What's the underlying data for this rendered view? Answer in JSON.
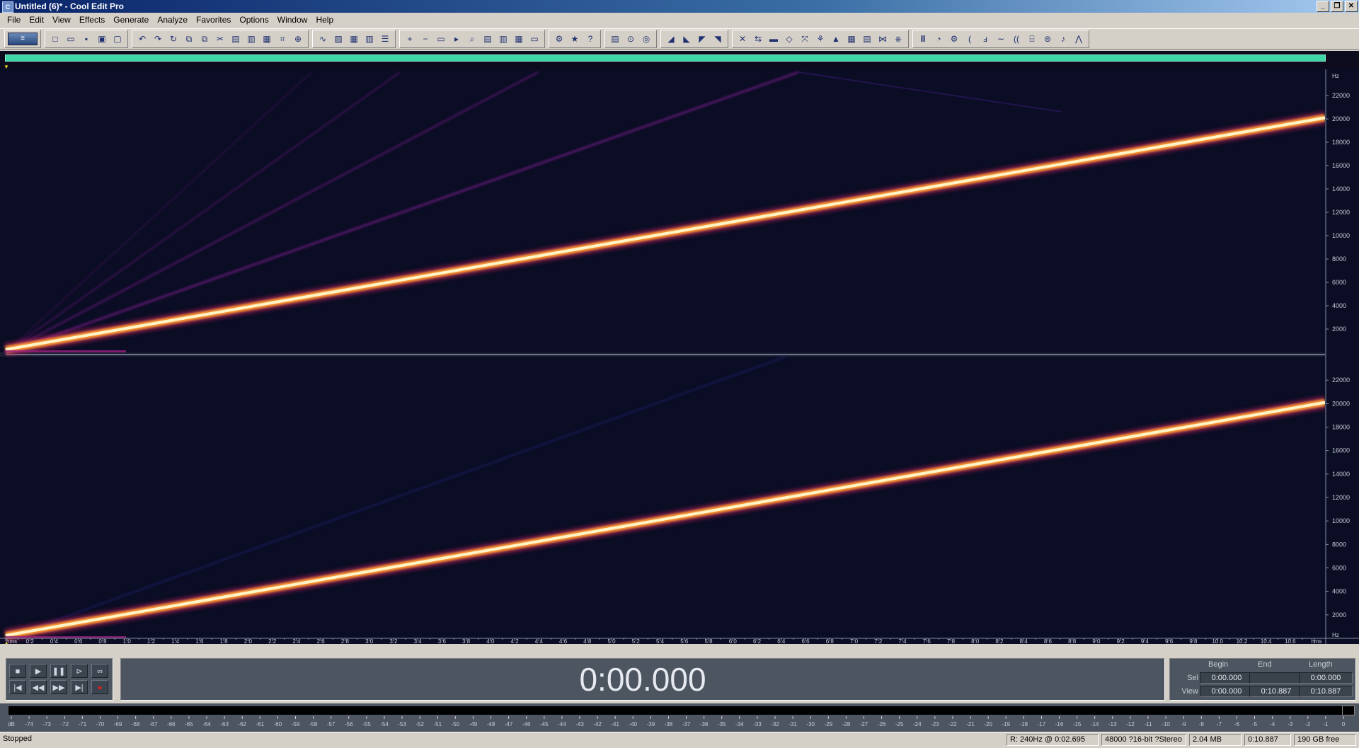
{
  "app": {
    "title": "Untitled (6)* - Cool Edit Pro",
    "icon": "cool-edit-app-icon",
    "window_buttons": [
      "_",
      "❐",
      "✕"
    ]
  },
  "menu": [
    "File",
    "Edit",
    "View",
    "Effects",
    "Generate",
    "Analyze",
    "Favorites",
    "Options",
    "Window",
    "Help"
  ],
  "toolbar": {
    "groups": [
      [
        "multitrack-toggle-icon"
      ],
      [
        "new-file-icon",
        "open-file-icon",
        "save-icon",
        "save-all-icon",
        "close-file-icon"
      ],
      [
        "undo-icon",
        "redo-icon",
        "repeat-icon",
        "copy-icon",
        "copy-new-icon",
        "cut-icon",
        "paste-icon",
        "paste-new-icon",
        "mix-paste-icon",
        "crop-icon",
        "insert-icon"
      ],
      [
        "waveform-view-icon",
        "spectral-view-icon",
        "grid-icon",
        "markers-icon",
        "cue-list-icon"
      ],
      [
        "zoom-in-icon",
        "zoom-out-icon",
        "zoom-full-icon",
        "play-cursor-icon",
        "zoom-selection-icon",
        "frames-icon",
        "bars-icon",
        "time-format-icon",
        "info-icon"
      ],
      [
        "settings-icon",
        "favorites-icon",
        "help-icon"
      ],
      [
        "channel-view-icon",
        "zoom-magnify-icon",
        "spectral-zoom-icon"
      ],
      [
        "amplify-icon",
        "normalize-icon",
        "envelope-icon",
        "fade-icon"
      ],
      [
        "noise-reduction-icon",
        "reverse-icon",
        "silence-icon",
        "invert-icon",
        "dynamics-icon",
        "filter-icon",
        "pitch-icon",
        "stretch-icon",
        "delay-icon",
        "chorus-icon",
        "echo-icon"
      ],
      [
        "graphic-eq-icon",
        "timer-icon",
        "gear-icon",
        "reverb-icon",
        "flanger-icon",
        "sweep-icon",
        "echo-chamber-icon",
        "distortion-icon",
        "hard-limit-icon",
        "music-icon",
        "shape-icon"
      ]
    ]
  },
  "spectral": {
    "freq_unit": "Hz",
    "freq_ticks": [
      "22000",
      "20000",
      "18000",
      "16000",
      "14000",
      "12000",
      "10000",
      "8000",
      "6000",
      "4000",
      "2000"
    ],
    "channel2_bottom_label": "Hz",
    "time_unit": "hms",
    "time_start": "hms",
    "time_ticks": [
      "0.2",
      "0.4",
      "0.6",
      "0.8",
      "1.0",
      "1.2",
      "1.4",
      "1.6",
      "1.8",
      "2.0",
      "2.2",
      "2.4",
      "2.6",
      "2.8",
      "3.0",
      "3.2",
      "3.4",
      "3.6",
      "3.8",
      "4.0",
      "4.2",
      "4.4",
      "4.6",
      "4.8",
      "5.0",
      "5.2",
      "5.4",
      "5.6",
      "5.8",
      "6.0",
      "6.2",
      "6.4",
      "6.6",
      "6.8",
      "7.0",
      "7.2",
      "7.4",
      "7.6",
      "7.8",
      "8.0",
      "8.2",
      "8.4",
      "8.6",
      "8.8",
      "9.0",
      "9.2",
      "9.4",
      "9.6",
      "9.8",
      "10.0",
      "10.2",
      "10.4",
      "10.6"
    ]
  },
  "transport": {
    "buttons_row1": [
      "stop-icon",
      "play-icon",
      "pause-icon",
      "play-to-end-icon",
      "loop-icon"
    ],
    "buttons_row2": [
      "go-to-start-icon",
      "rewind-icon",
      "fast-forward-icon",
      "go-to-end-icon",
      "record-icon"
    ]
  },
  "time_display": "0:00.000",
  "selection": {
    "headers": {
      "begin": "Begin",
      "end": "End",
      "length": "Length"
    },
    "sel": {
      "label": "Sel",
      "begin": "0:00.000",
      "end": "",
      "length": "0:00.000"
    },
    "view": {
      "label": "View",
      "begin": "0:00.000",
      "end": "0:10.887",
      "length": "0:10.887"
    }
  },
  "level_meter": {
    "ticks": [
      "dB",
      "-74",
      "-73",
      "-72",
      "-71",
      "-70",
      "-69",
      "-68",
      "-67",
      "-66",
      "-65",
      "-64",
      "-63",
      "-62",
      "-61",
      "-60",
      "-59",
      "-58",
      "-57",
      "-56",
      "-55",
      "-54",
      "-53",
      "-52",
      "-51",
      "-50",
      "-49",
      "-48",
      "-47",
      "-46",
      "-45",
      "-44",
      "-43",
      "-42",
      "-41",
      "-40",
      "-39",
      "-38",
      "-37",
      "-36",
      "-35",
      "-34",
      "-33",
      "-32",
      "-31",
      "-30",
      "-29",
      "-28",
      "-27",
      "-26",
      "-25",
      "-24",
      "-23",
      "-22",
      "-21",
      "-20",
      "-19",
      "-18",
      "-17",
      "-16",
      "-15",
      "-14",
      "-13",
      "-12",
      "-11",
      "-10",
      "-9",
      "-8",
      "-7",
      "-6",
      "-5",
      "-4",
      "-3",
      "-2",
      "-1",
      "0"
    ]
  },
  "status": {
    "text": "Stopped",
    "cursor": "R: 240Hz @  0:02.695",
    "format": "48000 ?16-bit ?Stereo",
    "size": "2.04 MB",
    "duration": "0:10.887",
    "free": "190 GB free"
  },
  "colors": {
    "spectrogram_bg": "#0a0d24",
    "sweep_core": "#fff4c8",
    "sweep_glow": "#ff9a30",
    "harmonic": "#7a1a8a",
    "overview_bar": "#3fd6a8"
  }
}
